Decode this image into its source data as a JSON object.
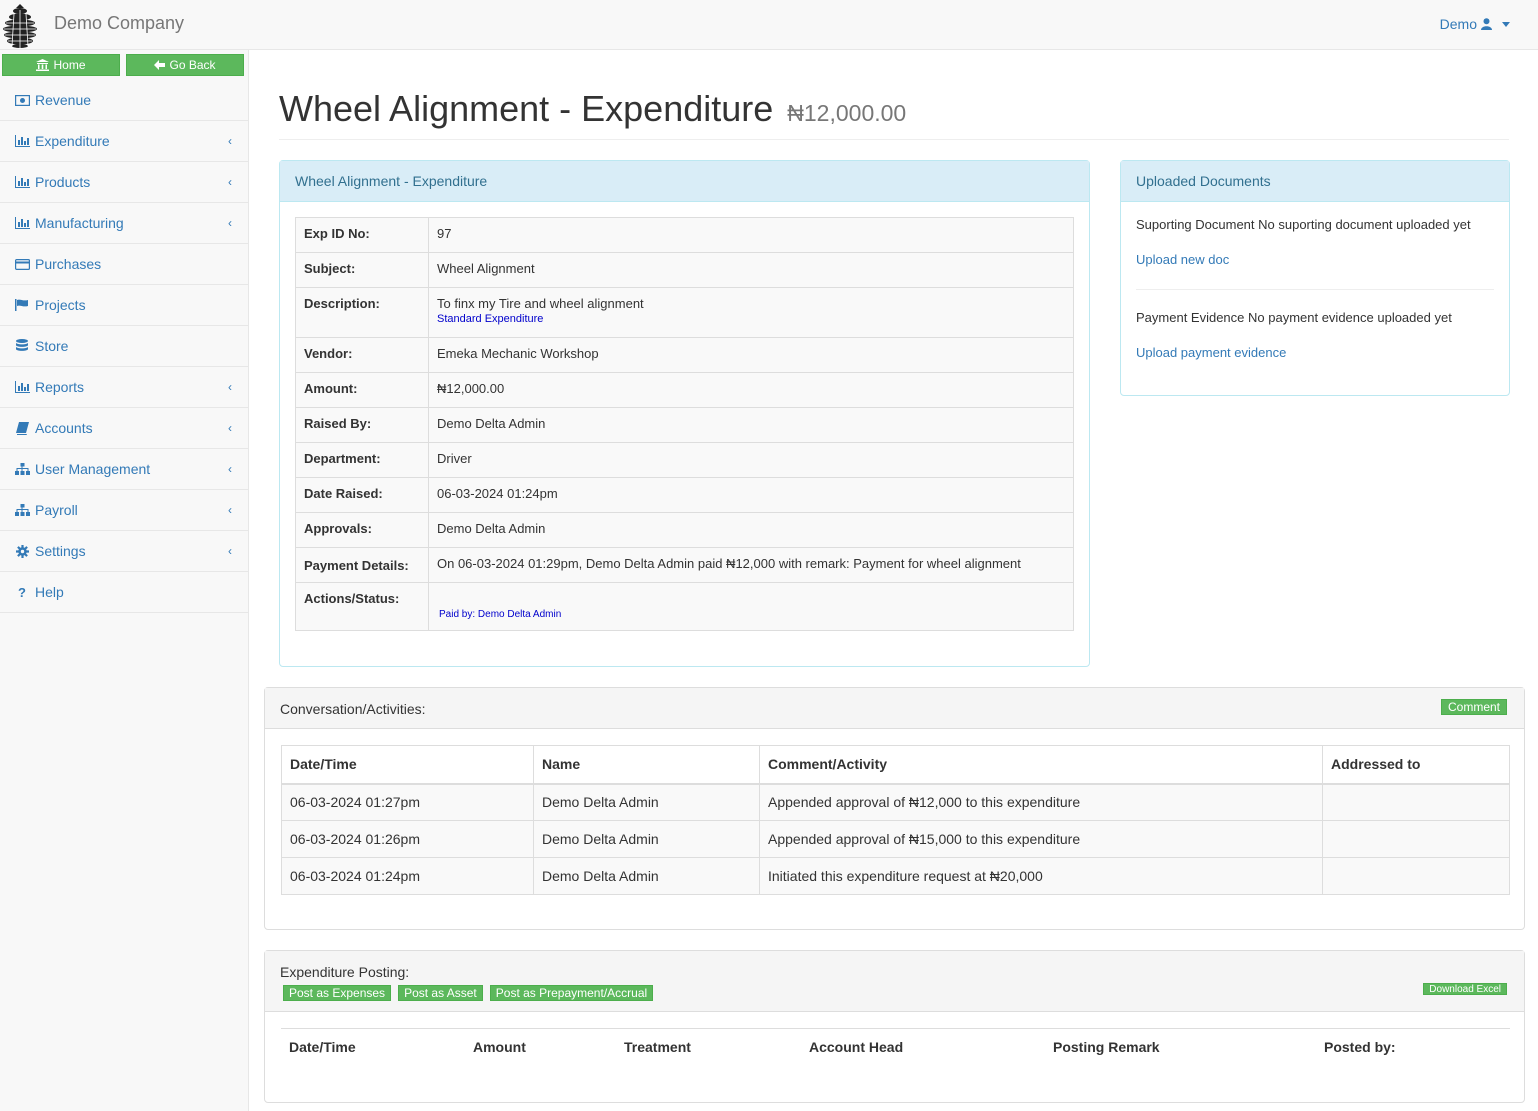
{
  "navbar": {
    "brand": "Demo Company",
    "user": "Demo"
  },
  "sidebar": {
    "home_label": "Home",
    "back_label": "Go Back",
    "items": [
      {
        "label": "Revenue",
        "icon": "money-icon",
        "has_submenu": false
      },
      {
        "label": "Expenditure",
        "icon": "bar-chart-icon",
        "has_submenu": true
      },
      {
        "label": "Products",
        "icon": "bar-chart-icon",
        "has_submenu": true
      },
      {
        "label": "Manufacturing",
        "icon": "bar-chart-icon",
        "has_submenu": true
      },
      {
        "label": "Purchases",
        "icon": "credit-card-icon",
        "has_submenu": false
      },
      {
        "label": "Projects",
        "icon": "flag-icon",
        "has_submenu": false
      },
      {
        "label": "Store",
        "icon": "database-icon",
        "has_submenu": false
      },
      {
        "label": "Reports",
        "icon": "bar-chart-icon",
        "has_submenu": true
      },
      {
        "label": "Accounts",
        "icon": "book-icon",
        "has_submenu": true
      },
      {
        "label": "User Management",
        "icon": "sitemap-icon",
        "has_submenu": true
      },
      {
        "label": "Payroll",
        "icon": "sitemap-icon",
        "has_submenu": true
      },
      {
        "label": "Settings",
        "icon": "gear-icon",
        "has_submenu": true
      },
      {
        "label": "Help",
        "icon": "question-icon",
        "has_submenu": false
      }
    ]
  },
  "page": {
    "title": "Wheel Alignment - Expenditure",
    "amount": "₦12,000.00"
  },
  "details": {
    "heading": "Wheel Alignment - Expenditure",
    "rows": [
      {
        "key": "Exp ID No:",
        "value": "97"
      },
      {
        "key": "Subject:",
        "value": "Wheel Alignment"
      },
      {
        "key": "Description:",
        "value": "To finx my Tire and wheel alignment",
        "sub": "Standard Expenditure"
      },
      {
        "key": "Vendor:",
        "value": "Emeka Mechanic Workshop"
      },
      {
        "key": "Amount:",
        "value": "₦12,000.00"
      },
      {
        "key": "Raised By:",
        "value": "Demo Delta Admin"
      },
      {
        "key": "Department:",
        "value": "Driver"
      },
      {
        "key": "Date Raised:",
        "value": "06-03-2024 01:24pm"
      },
      {
        "key": "Approvals:",
        "value": "Demo Delta Admin"
      },
      {
        "key": "Payment Details:",
        "value": "On 06-03-2024 01:29pm, Demo Delta Admin paid ₦12,000 with remark: Payment for wheel alignment"
      },
      {
        "key": "Actions/Status:",
        "value": "",
        "sub": "Paid by: Demo Delta Admin"
      }
    ]
  },
  "docs": {
    "heading": "Uploaded Documents",
    "supporting_text": "Suporting Document No suporting document uploaded yet",
    "upload_doc_link": "Upload new doc",
    "payment_text": "Payment Evidence No payment evidence uploaded yet",
    "upload_payment_link": "Upload payment evidence"
  },
  "conversation": {
    "heading": "Conversation/Activities:",
    "comment_label": "Comment",
    "columns": [
      "Date/Time",
      "Name",
      "Comment/Activity",
      "Addressed to"
    ],
    "rows": [
      [
        "06-03-2024 01:27pm",
        "Demo Delta Admin",
        "Appended approval of ₦12,000 to this expenditure",
        ""
      ],
      [
        "06-03-2024 01:26pm",
        "Demo Delta Admin",
        "Appended approval of ₦15,000 to this expenditure",
        ""
      ],
      [
        "06-03-2024 01:24pm",
        "Demo Delta Admin",
        "Initiated this expenditure request at ₦20,000",
        ""
      ]
    ]
  },
  "posting": {
    "heading": "Expenditure Posting:",
    "buttons": [
      "Post as Expenses",
      "Post as Asset",
      "Post as Prepayment/Accrual"
    ],
    "download_label": "Download Excel",
    "columns": [
      "Date/Time",
      "Amount",
      "Treatment",
      "Account Head",
      "Posting Remark",
      "Posted by:"
    ]
  },
  "colors": {
    "accent": "#337ab7",
    "success": "#5cb85c",
    "info_bg": "#d9edf7",
    "info_border": "#bce8f1"
  }
}
